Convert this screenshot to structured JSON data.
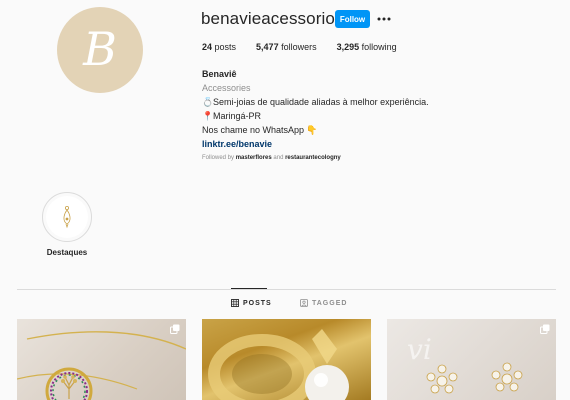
{
  "profile": {
    "avatar_letter": "B",
    "username": "benavieacessorios",
    "follow_label": "Follow",
    "stats": [
      {
        "count": "24",
        "label": "posts"
      },
      {
        "count": "5,477",
        "label": "followers"
      },
      {
        "count": "3,295",
        "label": "following"
      }
    ],
    "bio": {
      "name": "Benaviê",
      "category": "Accessories",
      "line1_icon": "💍",
      "line1": "Semi-joias de qualidade aliadas à melhor experiência.",
      "line2_icon": "📍",
      "line2": "Maringá-PR",
      "line3": "Nos chame no WhatsApp",
      "line3_icon": "👇",
      "link": "linktr.ee/benavie"
    },
    "followed_by": {
      "prefix": "Followed by",
      "user1": "masterflores",
      "joiner": "and",
      "user2": "restaurantecologny"
    }
  },
  "highlights": [
    {
      "label": "Destaques"
    }
  ],
  "tabs": [
    {
      "label": "POSTS",
      "active": true
    },
    {
      "label": "TAGGED",
      "active": false
    }
  ],
  "colors": {
    "follow_button": "#0095f6",
    "avatar_bg": "#e3d3b6",
    "link": "#00376b",
    "muted": "#8e8e8e"
  }
}
